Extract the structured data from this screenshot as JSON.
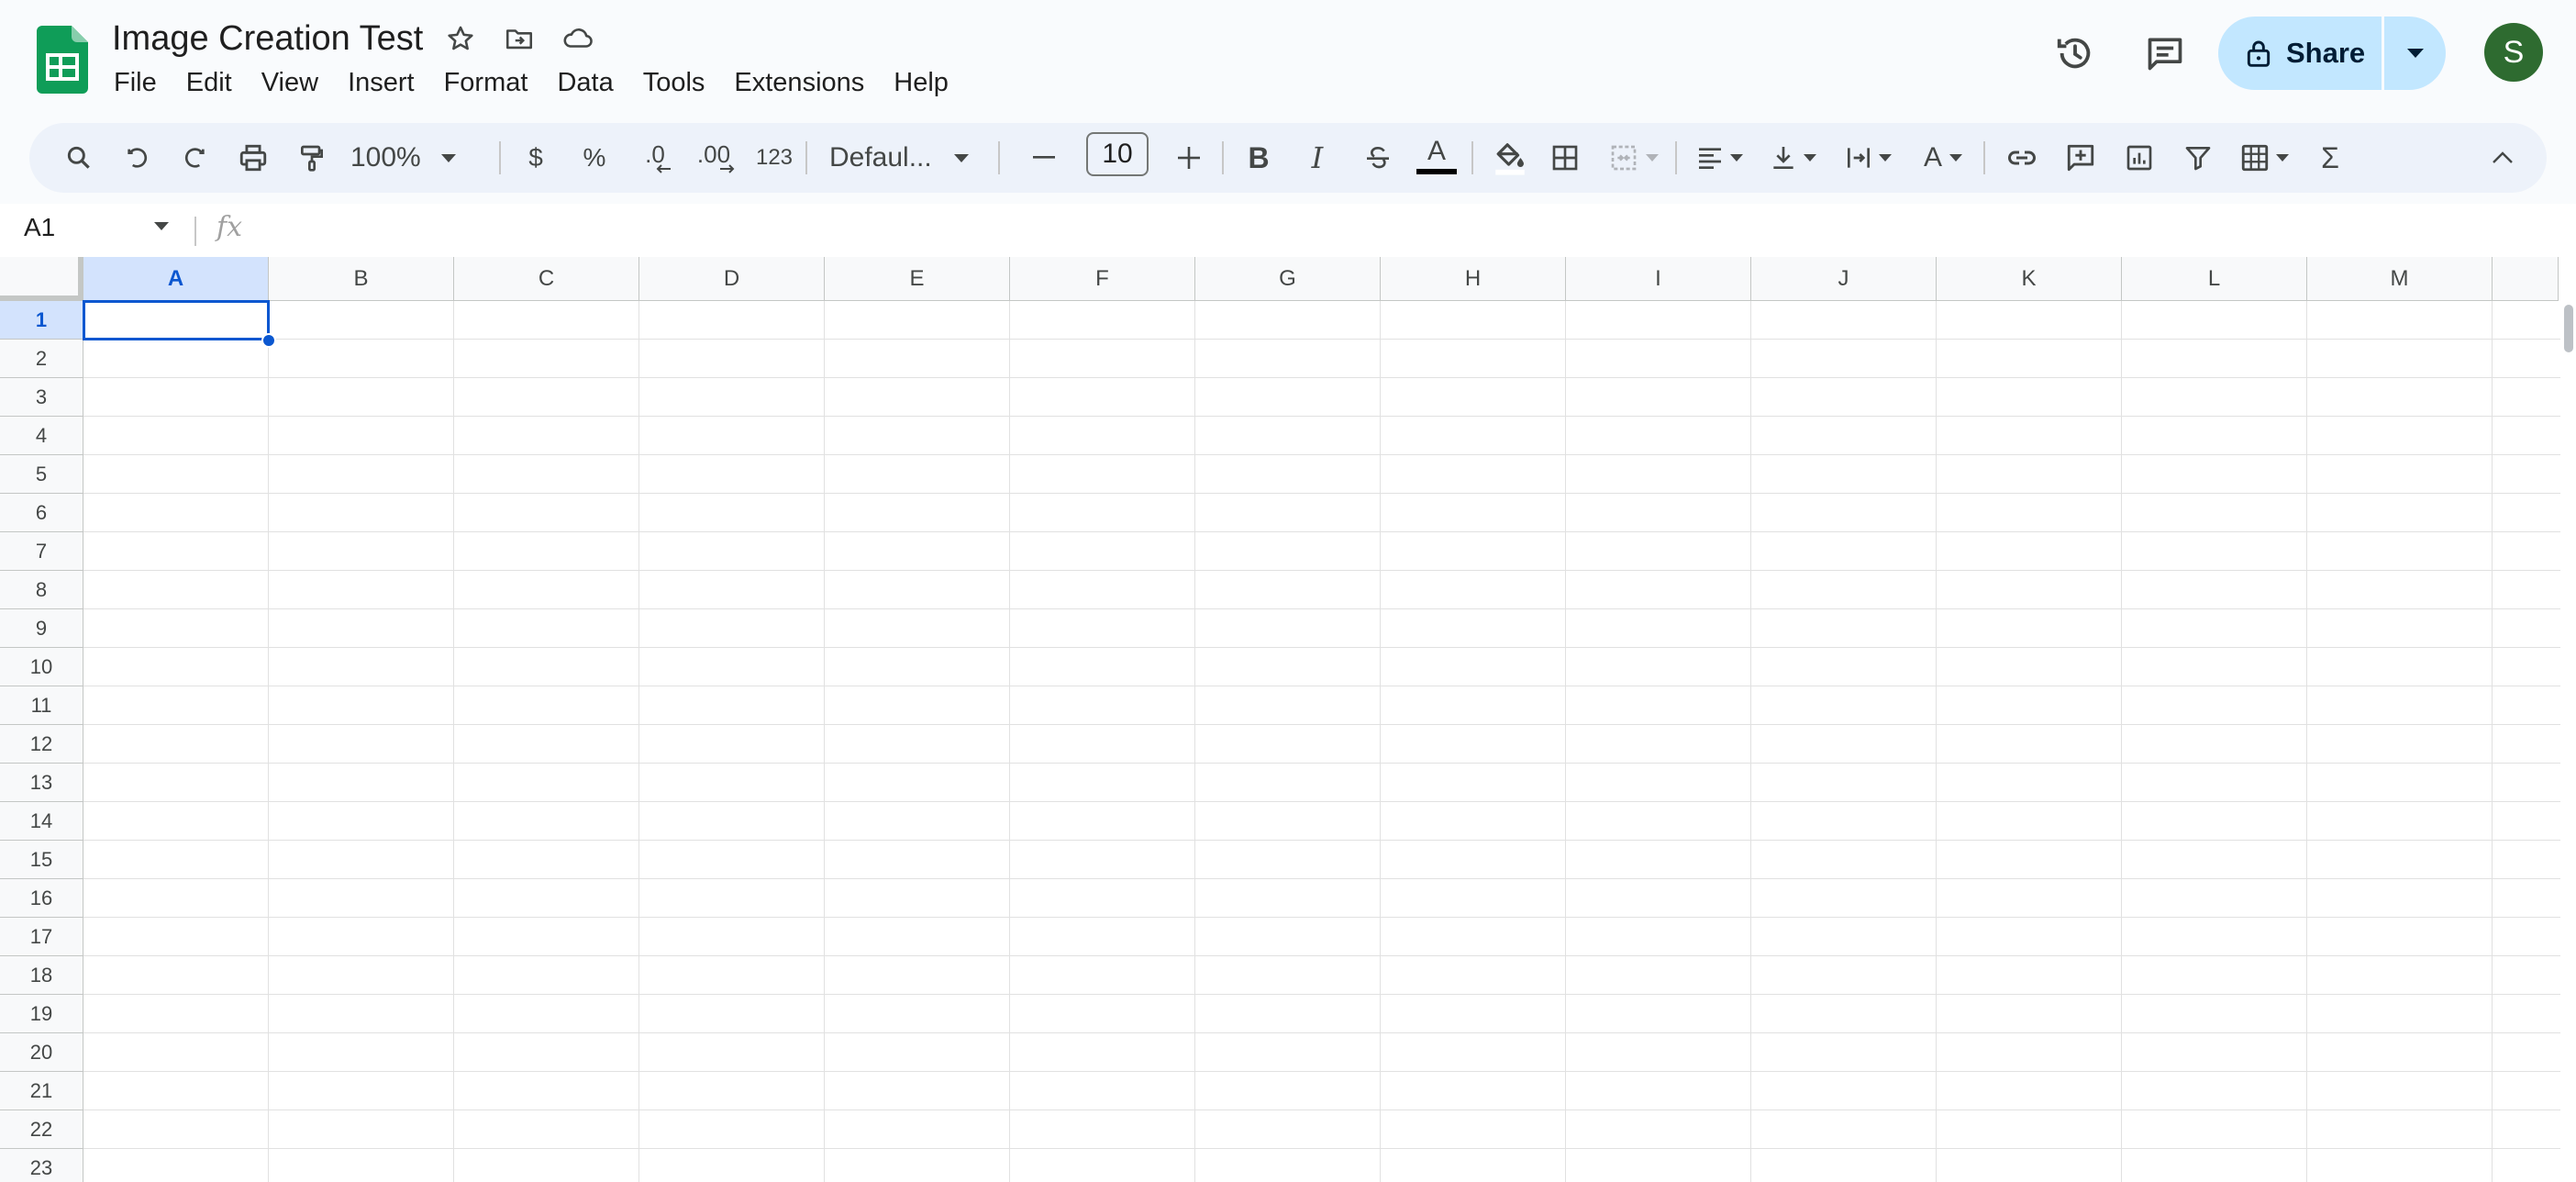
{
  "document": {
    "title": "Image Creation Test"
  },
  "menu": [
    "File",
    "Edit",
    "View",
    "Insert",
    "Format",
    "Data",
    "Tools",
    "Extensions",
    "Help"
  ],
  "share": {
    "label": "Share"
  },
  "user": {
    "avatar_letter": "S",
    "avatar_color": "#2e6b30"
  },
  "toolbar": {
    "zoom": "100%",
    "currency": "$",
    "percent": "%",
    "decrease_decimal": ".0",
    "increase_decimal": ".00",
    "number_format": "123",
    "font": "Defaul...",
    "font_size": "10",
    "bold": "B",
    "italic": "I",
    "text_color": "A",
    "text_rotation": "A",
    "functions": "Σ"
  },
  "formula_bar": {
    "cell_ref": "A1",
    "fx": "fx"
  },
  "grid": {
    "columns": [
      "A",
      "B",
      "C",
      "D",
      "E",
      "F",
      "G",
      "H",
      "I",
      "J",
      "K",
      "L",
      "M"
    ],
    "rows": [
      "1",
      "2",
      "3",
      "4",
      "5",
      "6",
      "7",
      "8",
      "9",
      "10",
      "11",
      "12",
      "13",
      "14",
      "15",
      "16",
      "17",
      "18",
      "19",
      "20",
      "21",
      "22",
      "23"
    ],
    "selected_column": "A",
    "selected_row": "1"
  },
  "colors": {
    "accent": "#0b57d0",
    "sheets_green": "#0f9d58",
    "share_bg": "#c2e7ff",
    "toolbar_bg": "#edf2fa"
  },
  "icons": [
    "sheets-logo-icon",
    "star-icon",
    "move-to-folder-icon",
    "cloud-saved-icon",
    "version-history-icon",
    "comments-icon",
    "lock-icon",
    "chevron-down-icon",
    "search-icon",
    "undo-icon",
    "redo-icon",
    "print-icon",
    "paint-format-icon",
    "strikethrough-icon",
    "fill-color-icon",
    "borders-icon",
    "merge-cells-icon",
    "horizontal-align-icon",
    "vertical-align-icon",
    "text-wrap-icon",
    "insert-link-icon",
    "insert-comment-icon",
    "insert-chart-icon",
    "filter-icon",
    "filter-views-icon",
    "collapse-toolbar-icon"
  ]
}
